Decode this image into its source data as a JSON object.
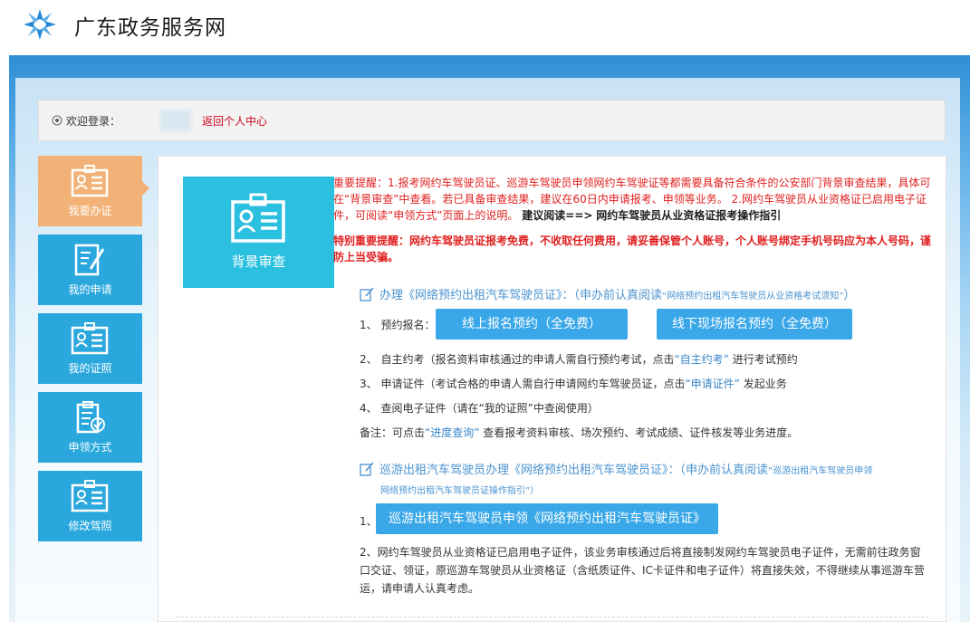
{
  "site": {
    "title": "广东政务服务网"
  },
  "welcome": {
    "label": "欢迎登录：",
    "back_link": "返回个人中心"
  },
  "sidebar": {
    "items": [
      {
        "label": "我要办证",
        "active": true
      },
      {
        "label": "我的申请"
      },
      {
        "label": "我的证照"
      },
      {
        "label": "申领方式"
      },
      {
        "label": "修改驾照"
      }
    ]
  },
  "card": {
    "label": "背景审查"
  },
  "notice": {
    "part1": "重要提醒：1.报考网约车驾驶员证、巡游车驾驶员申领网约车驾驶证等都需要具备符合条件的公安部门背景审查结果，具体可在“背景审查”中查看。若已具备审查结果，建议在60日内申请报考、申领等业务。 2.网约车驾驶员从业资格证已启用电子证件，可阅读“申领方式”页面上的说明。",
    "read_prefix": "建议阅读==>",
    "read_link": "网约车驾驶员从业资格证报考操作指引",
    "important": "特别重要提醒：网约车驾驶员证报考免费，不收取任何费用，请妥善保管个人账号，个人账号绑定手机号码应为本人号码，谨防上当受骗。"
  },
  "section1": {
    "title": "办理《网络预约出租汽车驾驶员证》：（申办前认真阅读",
    "title_small": "“网络预约出租汽车驾驶员从业资格考试须知”",
    "title_end": "）",
    "step1_label": "1、 预约报名：",
    "btn_online": "线上报名预约（全免费）",
    "btn_offline": "线下现场报名预约（全免费）",
    "step2_a": "2、 自主约考（报名资料审核通过的申请人需自行预约考试，点击",
    "step2_link": "“自主约考”",
    "step2_b": "进行考试预约",
    "step3_a": "3、 申请证件（考试合格的申请人需自行申请网约车驾驶员证，点击",
    "step3_link": "“申请证件”",
    "step3_b": "发起业务",
    "step4": "4、 查阅电子证件（请在“我的证照”中查阅使用）",
    "remark_a": "备注：可点击",
    "remark_link": "“进度查询”",
    "remark_b": "查看报考资料审核、场次预约、考试成绩、证件核发等业务进度。"
  },
  "section2": {
    "title": "巡游出租汽车驾驶员办理《网络预约出租汽车驾驶员证》：（申办前认真阅读",
    "title_small": "“巡游出租汽车驾驶员申领",
    "title_line2": "网络预约出租汽车驾驶员证操作指引”）",
    "step1_label": "1、",
    "btn_cruise": "巡游出租汽车驾驶员申领《网络预约出租汽车驾驶员证》",
    "para": "2、网约车驾驶员从业资格证已启用电子证件，该业务审核通过后将直接制发网约车驾驶员电子证件，无需前往政务窗口交证、领证，原巡游车驾驶员从业资格证（含纸质证件、IC卡证件和电子证件）将直接失效，不得继续从事巡游车营运，请申请人认真考虑。"
  },
  "colors": {
    "nav_blue": "#2aa8de",
    "nav_active": "#f2b277",
    "button_blue": "#39a7e8",
    "alert_red": "#e02020"
  }
}
